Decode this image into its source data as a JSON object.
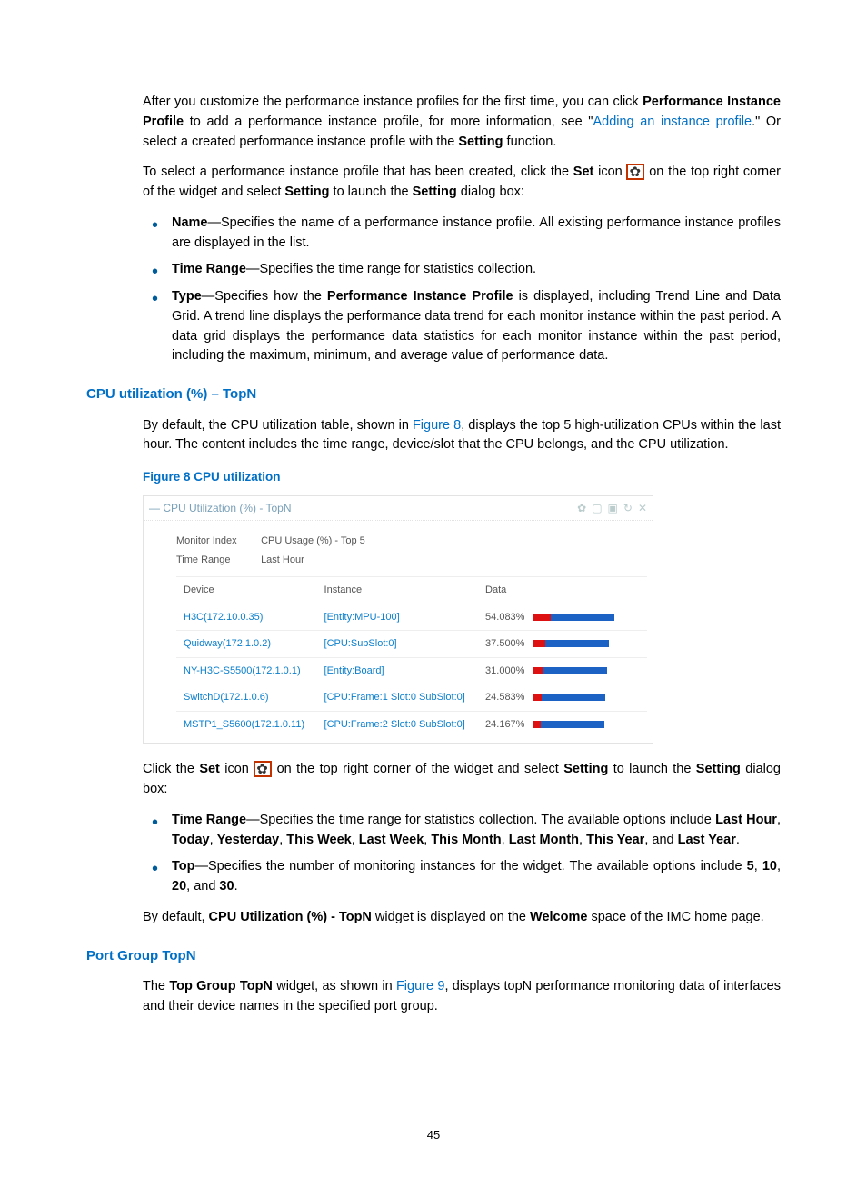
{
  "para1": {
    "t1": "After you customize the performance instance profiles for the first time, you can click ",
    "b1": "Performance Instance Profile",
    "t2": " to add a performance instance profile, for more information, see \"",
    "link1": "Adding an instance profile",
    "t3": ".\" Or select a created performance instance profile with the ",
    "b2": "Setting",
    "t4": " function."
  },
  "para2": {
    "t1": "To select a performance instance profile that has been created, click the ",
    "b1": "Set",
    "t2": " icon ",
    "t3": " on the top right corner of the widget and select ",
    "b2": "Setting",
    "t4": " to launch the ",
    "b3": "Setting",
    "t5": " dialog box:"
  },
  "list1": {
    "li1": {
      "b": "Name",
      "t": "—Specifies the name of a performance instance profile. All existing performance instance profiles are displayed in the list."
    },
    "li2": {
      "b": "Time Range",
      "t": "—Specifies the time range for statistics collection."
    },
    "li3": {
      "b": "Type",
      "t1": "—Specifies how the ",
      "b2": "Performance Instance Profile",
      "t2": " is displayed, including Trend Line and Data Grid. A trend line displays the performance data trend for each monitor instance within the past period. A data grid displays the performance data statistics for each monitor instance within the past period, including the maximum, minimum, and average value of performance data."
    }
  },
  "section1": "CPU utilization (%) – TopN",
  "para3": {
    "t1": "By default, the CPU utilization table, shown in ",
    "link": "Figure 8",
    "t2": ", displays the top 5 high-utilization CPUs within the last hour. The content includes the time range, device/slot that the CPU belongs, and the CPU utilization."
  },
  "figcap": "Figure 8 CPU utilization",
  "widget": {
    "title": "— CPU Utilization (%) - TopN",
    "monitor_label": "Monitor Index",
    "monitor_value": "CPU Usage (%) - Top 5",
    "time_label": "Time Range",
    "time_value": "Last Hour",
    "h0": "Device",
    "h1": "Instance",
    "h2": "Data"
  },
  "chart_data": {
    "type": "table",
    "title": "CPU Utilization (%) - TopN",
    "monitor_index": "CPU Usage (%) - Top 5",
    "time_range": "Last Hour",
    "columns": [
      "Device",
      "Instance",
      "Data"
    ],
    "rows": [
      {
        "device": "H3C(172.10.0.35)",
        "instance": "[Entity:MPU-100]",
        "value": 54.083,
        "label": "54.083%"
      },
      {
        "device": "Quidway(172.1.0.2)",
        "instance": "[CPU:SubSlot:0]",
        "value": 37.5,
        "label": "37.500%"
      },
      {
        "device": "NY-H3C-S5500(172.1.0.1)",
        "instance": "[Entity:Board]",
        "value": 31.0,
        "label": "31.000%"
      },
      {
        "device": "SwitchD(172.1.0.6)",
        "instance": "[CPU:Frame:1 Slot:0 SubSlot:0]",
        "value": 24.583,
        "label": "24.583%"
      },
      {
        "device": "MSTP1_S5600(172.1.0.11)",
        "instance": "[CPU:Frame:2 Slot:0 SubSlot:0]",
        "value": 24.167,
        "label": "24.167%"
      }
    ]
  },
  "para4": {
    "t1": "Click the ",
    "b1": "Set",
    "t2": " icon ",
    "t3": " on the top right corner of the widget and select ",
    "b2": "Setting",
    "t4": " to launch the ",
    "b3": "Setting",
    "t5": " dialog box:"
  },
  "list2": {
    "li1": {
      "b": "Time Range",
      "t1": "—Specifies the time range for statistics collection. The available options include ",
      "opts": [
        "Last Hour",
        "Today",
        "Yesterday",
        "This Week",
        "Last Week",
        "This Month",
        "Last Month",
        "This Year"
      ],
      "and": ", and ",
      "last": "Last Year",
      "dot": "."
    },
    "li2": {
      "b": "Top",
      "t1": "—Specifies the number of monitoring instances for the widget. The available options include ",
      "o1": "5",
      "o2": "10",
      "o3": "20",
      "and": ", and ",
      "o4": "30",
      "dot": "."
    }
  },
  "para5": {
    "t1": "By default, ",
    "b1": "CPU Utilization (%) - TopN",
    "t2": " widget is displayed on the ",
    "b2": "Welcome",
    "t3": " space of the IMC home page."
  },
  "section2": "Port Group TopN",
  "para6": {
    "t1": "The ",
    "b1": "Top Group TopN",
    "t2": " widget, as shown in ",
    "link": "Figure 9",
    "t3": ", displays topN performance monitoring data of interfaces and their device names in the specified port group."
  },
  "page": "45"
}
